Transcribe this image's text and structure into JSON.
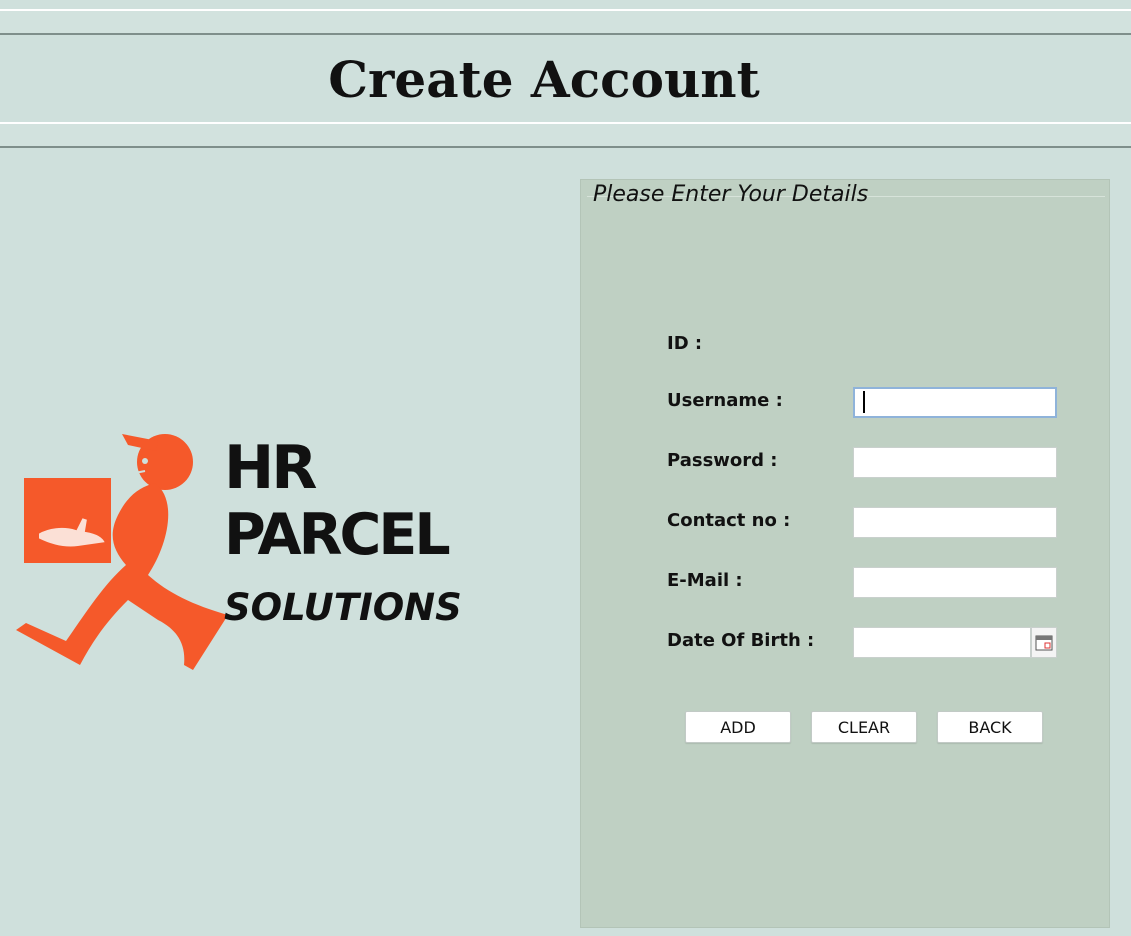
{
  "header": {
    "title": "Create Account"
  },
  "logo": {
    "line1": "HR",
    "line2": "PARCEL",
    "line3": "SOLUTIONS",
    "accent_color": "#f5592a"
  },
  "form": {
    "panel_title": "Please Enter Your Details",
    "fields": [
      {
        "label": "ID :",
        "value": ""
      },
      {
        "label": "Username :",
        "value": ""
      },
      {
        "label": "Password :",
        "value": ""
      },
      {
        "label": "Contact no :",
        "value": ""
      },
      {
        "label": "E-Mail :",
        "value": ""
      },
      {
        "label": "Date Of Birth :",
        "value": ""
      }
    ],
    "buttons": {
      "add": "ADD",
      "clear": "CLEAR",
      "back": "BACK"
    }
  }
}
